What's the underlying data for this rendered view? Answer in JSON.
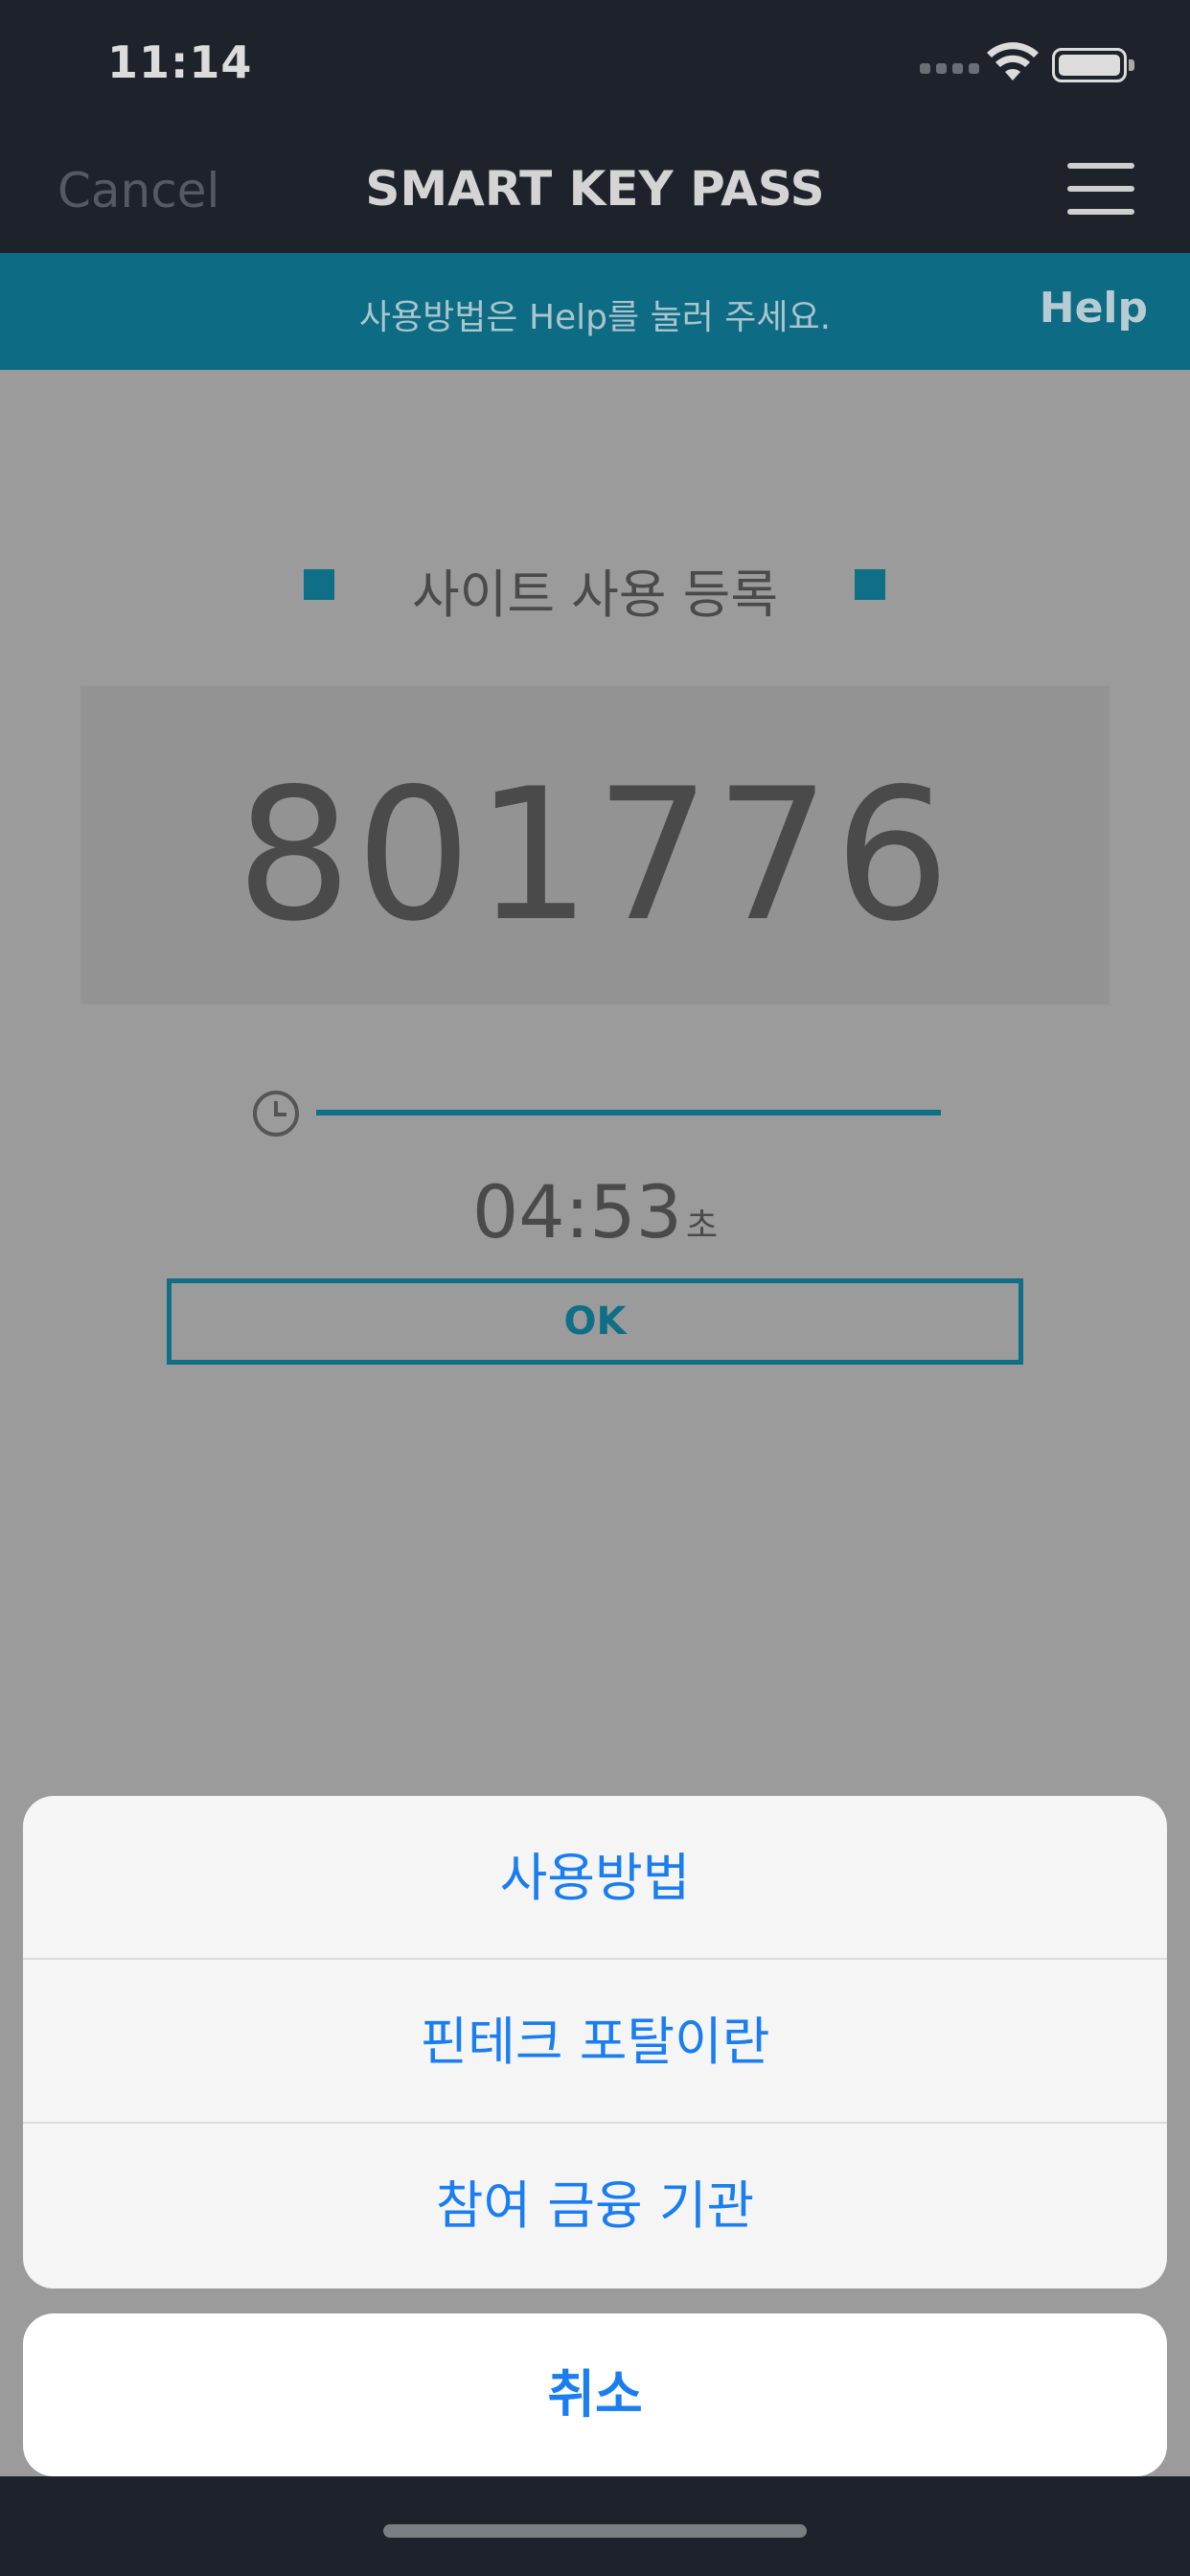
{
  "status_bar": {
    "time": "11:14"
  },
  "nav": {
    "cancel_label": "Cancel",
    "title": "SMART KEY PASS"
  },
  "help_bar": {
    "text": "사용방법은 Help를 눌러 주세요.",
    "help_label": "Help"
  },
  "main": {
    "section_title": "사이트 사용 등록",
    "code": "801776",
    "progress": 1.0,
    "timer": "04:53",
    "timer_unit": "초",
    "ok_label": "OK"
  },
  "action_sheet": {
    "options": [
      {
        "label": "사용방법"
      },
      {
        "label": "핀테크 포탈이란"
      },
      {
        "label": "참여 금융 기관"
      }
    ],
    "cancel_label": "취소"
  },
  "colors": {
    "accent": "#0e6f87",
    "ios_blue": "#1a7df0",
    "dark_bg": "#1e232b",
    "dim_bg": "#9b9b9b"
  }
}
